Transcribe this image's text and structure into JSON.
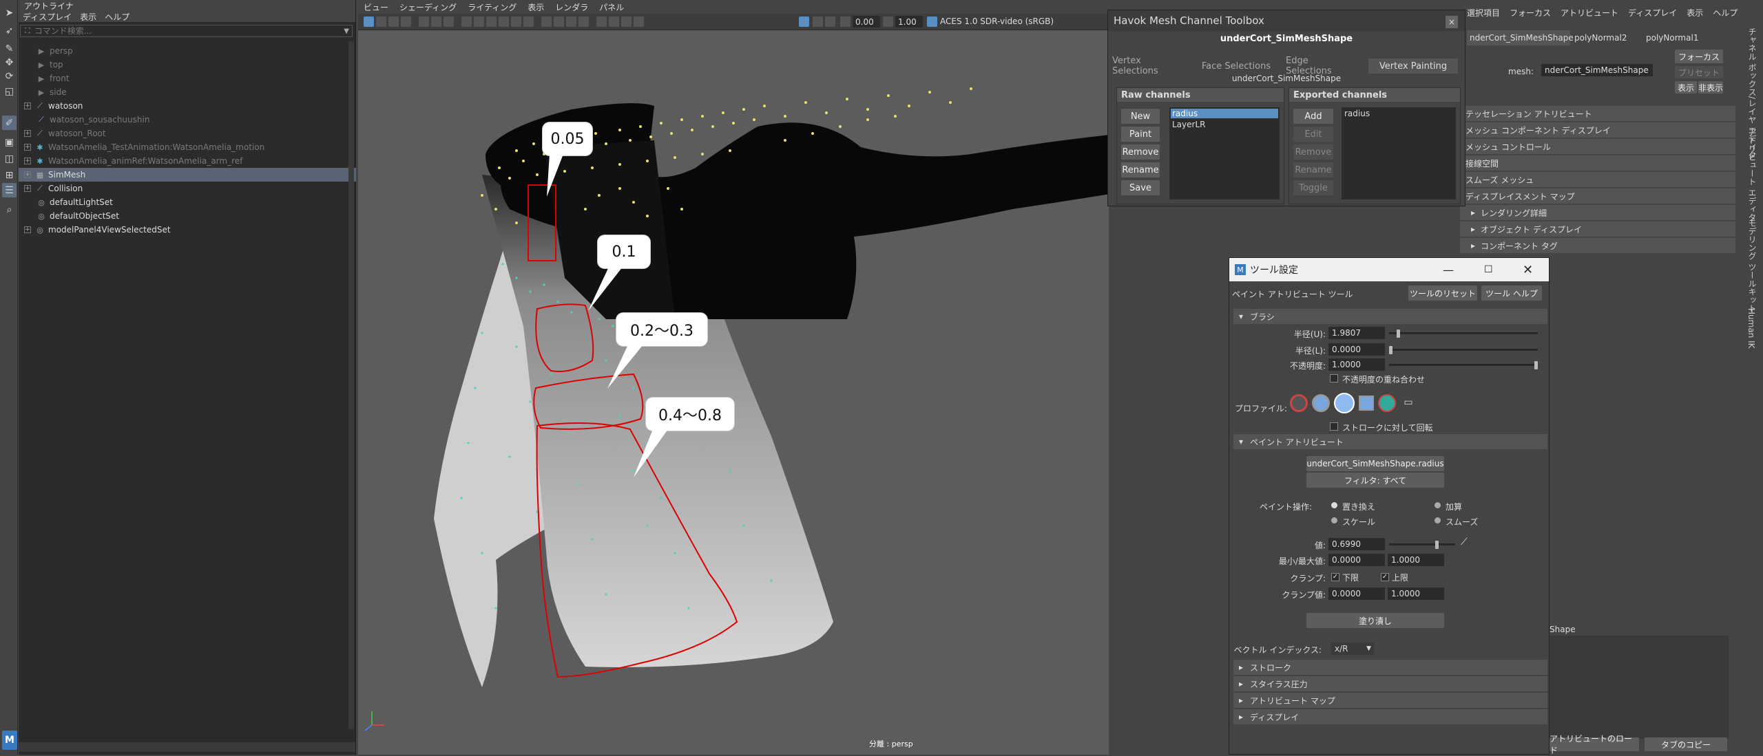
{
  "outliner": {
    "title": "アウトライナ",
    "menu": [
      "ディスプレイ",
      "表示",
      "ヘルプ"
    ],
    "search_placeholder": "コマンド検索...",
    "items": [
      {
        "label": "persp",
        "dim": true
      },
      {
        "label": "top",
        "dim": true
      },
      {
        "label": "front",
        "dim": true
      },
      {
        "label": "side",
        "dim": true
      },
      {
        "label": "watoson",
        "dim": false
      },
      {
        "label": "watoson_sousachuushin",
        "dim": true
      },
      {
        "label": "watoson_Root",
        "dim": true
      },
      {
        "label": "WatsonAmelia_TestAnimation:WatsonAmelia_motion",
        "dim": true
      },
      {
        "label": "WatsonAmelia_animRef:WatsonAmelia_arm_ref",
        "dim": true
      },
      {
        "label": "SimMesh",
        "dim": false,
        "selected": true
      },
      {
        "label": "Collision",
        "dim": false
      },
      {
        "label": "defaultLightSet",
        "dim": false
      },
      {
        "label": "defaultObjectSet",
        "dim": false
      },
      {
        "label": "modelPanel4ViewSelectedSet",
        "dim": false
      }
    ]
  },
  "viewport": {
    "menu": [
      "ビュー",
      "シェーディング",
      "ライティング",
      "表示",
      "レンダラ",
      "パネル"
    ],
    "near_value": "0.00",
    "far_value": "1.00",
    "color_space": "ACES 1.0 SDR-video (sRGB)",
    "camera_label": "persp",
    "camera_prefix": "分離",
    "callouts": [
      "0.05",
      "0.1",
      "0.2〜0.3",
      "0.4〜0.8"
    ]
  },
  "havok": {
    "title": "Havok Mesh Channel Toolbox",
    "shape_name": "underCort_SimMeshShape",
    "shape_sub": "underCort_SimMeshShape",
    "tabs": [
      "Vertex Selections",
      "Face Selections",
      "Edge Selections",
      "Vertex Painting"
    ],
    "active_tab": "Vertex Painting",
    "raw_title": "Raw channels",
    "exported_title": "Exported channels",
    "raw_buttons": [
      "New",
      "Paint",
      "Remove",
      "Rename",
      "Save"
    ],
    "raw_list": [
      "radius",
      "LayerLR"
    ],
    "exported_buttons": [
      "Add",
      "Edit",
      "Remove",
      "Rename",
      "Toggle"
    ],
    "exported_list": [
      "radius"
    ]
  },
  "tool_settings": {
    "title": "ツール設定",
    "tool_name": "ペイント アトリビュート ツール",
    "reset_button": "ツールのリセット",
    "help_button": "ツール ヘルプ",
    "brush_section": "ブラシ",
    "radius_u_label": "半径(U):",
    "radius_u": "1.9807",
    "radius_u_level": 0.05,
    "radius_l_label": "半径(L):",
    "radius_l": "0.0000",
    "radius_l_level": 0.0,
    "opacity_label": "不透明度:",
    "opacity": "1.0000",
    "opacity_level": 1.0,
    "accumulate_opacity": "不透明度の重ね合わせ",
    "profile_label": "プロファイル:",
    "rotate_stroke": "ストロークに対して回転",
    "paint_attr_section": "ペイント アトリビュート",
    "attr_name": "underCort_SimMeshShape.radius",
    "filter_label": "フィルタ: すべて",
    "paint_op_label": "ペイント操作:",
    "ops": [
      "置き換え",
      "加算",
      "スケール",
      "スムーズ"
    ],
    "value_label": "値:",
    "value": "0.6990",
    "value_level": 0.699,
    "minmax_label": "最小/最大値:",
    "min": "0.0000",
    "max": "1.0000",
    "clamp_label": "クランプ:",
    "clamp_lower": "下限",
    "clamp_upper": "上限",
    "clamp_val_label": "クランプ値:",
    "clamp_min": "0.0000",
    "clamp_max": "1.0000",
    "flood_button": "塗り潰し",
    "vector_index_label": "ベクトル インデックス:",
    "vector_index": "x/R",
    "collapsed_sections": [
      "ストローク",
      "スタイラス圧力",
      "アトリビュート マップ",
      "ディスプレイ"
    ]
  },
  "attribute_editor": {
    "menu": [
      "選択項目",
      "フォーカス",
      "アトリビュート",
      "ディスプレイ",
      "表示",
      "ヘルプ"
    ],
    "tabs": [
      "nderCort_SimMeshShape",
      "polyNormal2",
      "polyNormal1"
    ],
    "mesh_label": "mesh:",
    "mesh_value": "nderCort_SimMeshShape",
    "focus_button": "フォーカス",
    "preset_button": "プリセット",
    "show_button": "表示",
    "hide_button": "非表示",
    "sections": [
      "テッセレーション アトリビュート",
      "メッシュ コンポーネント ディスプレイ",
      "メッシュ コントロール",
      "接線空間",
      "スムーズ メッシュ",
      "ディスプレイスメント マップ",
      "レンダリング詳細",
      "オブジェクト ディスプレイ",
      "コンポーネント タグ"
    ],
    "shape_label": "Shape",
    "load_attr_button": "アトリビュートのロード",
    "copy_tab_button": "タブのコピー",
    "side_tabs": [
      "チャネル ボックス/レイヤ エディタ",
      "アトリビュート エディタ",
      "モデリング ツールキット",
      "Human IK"
    ]
  }
}
